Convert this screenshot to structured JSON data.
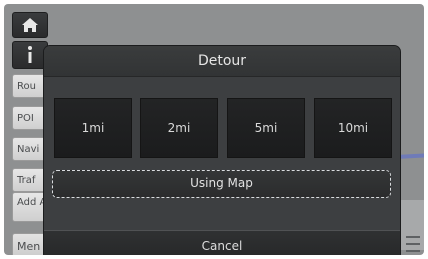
{
  "sidebar": {
    "home_icon": "home-icon",
    "info_icon": "info-icon",
    "items": [
      {
        "label": "Rou"
      },
      {
        "label": "POI"
      },
      {
        "label": "Navi"
      },
      {
        "label": "Traf"
      },
      {
        "label": "Add Add"
      },
      {
        "label": "Men"
      }
    ]
  },
  "dialog": {
    "title": "Detour",
    "options": [
      {
        "label": "1mi"
      },
      {
        "label": "2mi"
      },
      {
        "label": "5mi"
      },
      {
        "label": "10mi"
      }
    ],
    "using_map_label": "Using Map",
    "cancel_label": "Cancel"
  },
  "colors": {
    "dialog_bg": "#3d3f41",
    "option_bg": "#1e1f20",
    "map_bg": "#8e9091",
    "focus_outline": "#d9dcdf"
  }
}
